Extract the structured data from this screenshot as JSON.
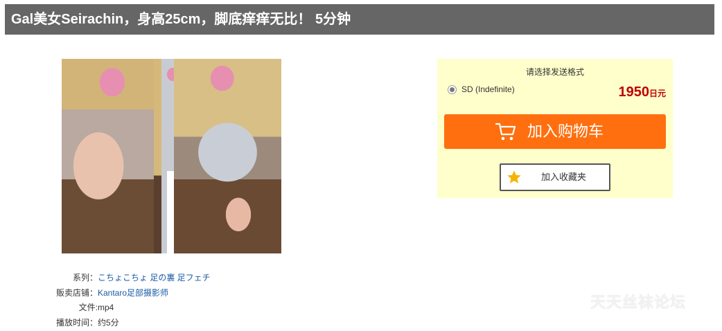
{
  "page_title": "Gal美女Seirachin，身高25cm，脚底痒痒无比！ 5分钟",
  "info": {
    "series_label": "系列：",
    "series_value": "こちょこちょ 足の裏 足フェチ",
    "store_label": "贩卖店铺：",
    "store_value": "Kantaro足部摄影师",
    "file_label": "文件:",
    "file_value": "mp4",
    "duration_label": "播放时间：",
    "duration_value": "约5分"
  },
  "purchase": {
    "format_prompt": "请选择发送格式",
    "format_option": "SD (Indefinite)",
    "price_value": "1950",
    "price_unit": "日元",
    "add_to_cart_label": "加入购物车",
    "add_to_favorites_label": "加入收藏夹"
  },
  "watermark": "天天丝袜论坛",
  "colors": {
    "title_bar": "#666666",
    "buy_box": "#ffffcc",
    "cart_button": "#ff6f0f",
    "price": "#c00000",
    "link": "#1a5aa6",
    "star": "#f5b301"
  },
  "icons": [
    "cart-icon",
    "star-icon"
  ]
}
